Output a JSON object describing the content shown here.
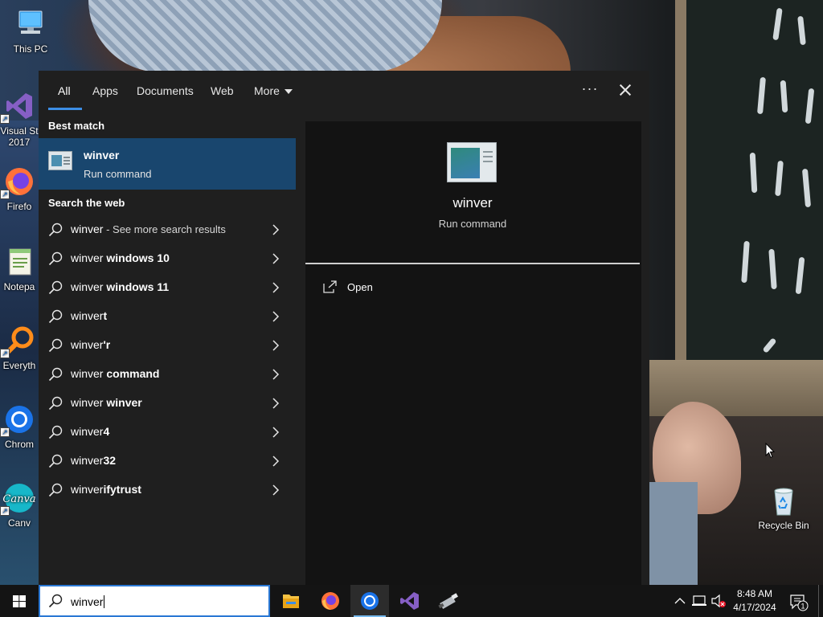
{
  "desktop": {
    "icons": [
      {
        "label": "This PC",
        "icon": "computer-icon"
      },
      {
        "label": "Visual St\n2017",
        "icon": "visual-studio-icon"
      },
      {
        "label": "Firefo",
        "icon": "firefox-icon"
      },
      {
        "label": "Notepa",
        "icon": "notepad-icon"
      },
      {
        "label": "Everyth",
        "icon": "everything-search-icon"
      },
      {
        "label": "Chrom",
        "icon": "chrome-icon"
      },
      {
        "label": "Canv",
        "icon": "canva-icon"
      },
      {
        "label": "Recycle Bin",
        "icon": "recycle-bin-icon"
      }
    ]
  },
  "search_flyout": {
    "tabs": [
      {
        "label": "All",
        "active": true
      },
      {
        "label": "Apps"
      },
      {
        "label": "Documents"
      },
      {
        "label": "Web"
      },
      {
        "label": "More"
      }
    ],
    "best_match_header": "Best match",
    "best_match": {
      "title": "winver",
      "subtitle": "Run command"
    },
    "web_header": "Search the web",
    "web_results": [
      {
        "prefix": "winver",
        "bold": "",
        "suffix": " - See more search results"
      },
      {
        "prefix": "winver ",
        "bold": "windows 10",
        "suffix": ""
      },
      {
        "prefix": "winver ",
        "bold": "windows 11",
        "suffix": ""
      },
      {
        "prefix": "winver",
        "bold": "t",
        "suffix": ""
      },
      {
        "prefix": "winver",
        "bold": "'r",
        "suffix": ""
      },
      {
        "prefix": "winver ",
        "bold": "command",
        "suffix": ""
      },
      {
        "prefix": "winver ",
        "bold": "winver",
        "suffix": ""
      },
      {
        "prefix": "winver",
        "bold": "4",
        "suffix": ""
      },
      {
        "prefix": "winver",
        "bold": "32",
        "suffix": ""
      },
      {
        "prefix": "winver",
        "bold": "ifytrust",
        "suffix": ""
      }
    ],
    "preview": {
      "title": "winver",
      "subtitle": "Run command",
      "action_open": "Open"
    }
  },
  "taskbar": {
    "search_value": "winver",
    "apps": [
      "file-explorer-icon",
      "firefox-icon",
      "chrome-icon",
      "visual-studio-icon",
      "usb-drive-icon"
    ],
    "clock_time": "8:48 AM",
    "clock_date": "4/17/2024",
    "notification_count": "1"
  },
  "colors": {
    "accent": "#3c8ee6",
    "selection": "#19466e",
    "flyout_bg": "#1f1f1f",
    "preview_bg": "#131313",
    "taskbar_bg": "#141414"
  }
}
